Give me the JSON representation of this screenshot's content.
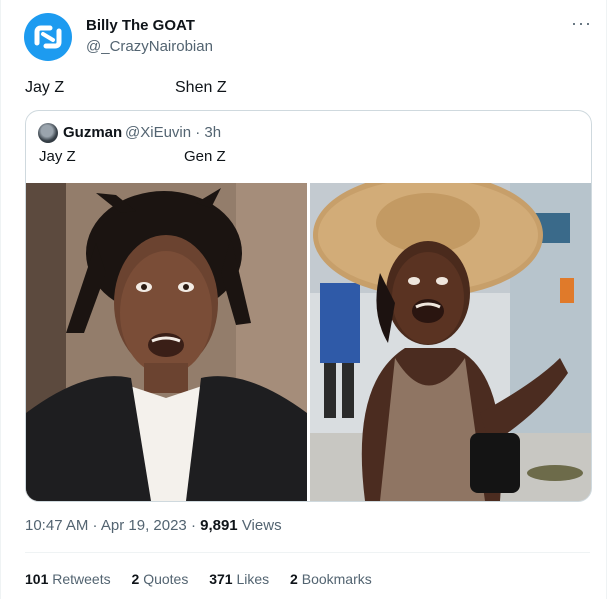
{
  "author": {
    "display_name": "Billy The GOAT",
    "handle": "@_CrazyNairobian",
    "avatar_color": "#1d9bf0"
  },
  "more_icon": "···",
  "tweet": {
    "text_left": "Jay Z",
    "text_right": "Shen Z"
  },
  "quoted_tweet": {
    "display_name": "Guzman",
    "meta": "@XiEuvin · 3h",
    "text_left": "Jay Z",
    "text_right": "Gen Z",
    "images": [
      "man-in-suit-surprised-photo",
      "woman-in-straw-hat-photo"
    ]
  },
  "timestamp": {
    "time_date": "10:47 AM · Apr 19, 2023 · ",
    "views_count": "9,891",
    "views_label": " Views"
  },
  "stats": {
    "retweets_count": "101",
    "retweets_label": "Retweets",
    "quotes_count": "2",
    "quotes_label": "Quotes",
    "likes_count": "371",
    "likes_label": "Likes",
    "bookmarks_count": "2",
    "bookmarks_label": "Bookmarks"
  }
}
